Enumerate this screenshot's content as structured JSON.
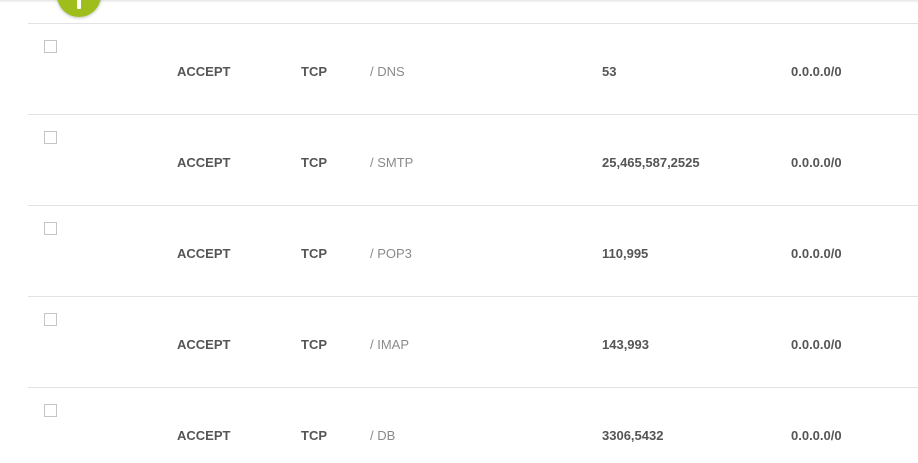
{
  "add_button": {
    "icon": "plus-icon",
    "color": "#9fbe1c"
  },
  "rules": [
    {
      "action": "ACCEPT",
      "protocol": "TCP",
      "service": "/ DNS",
      "ports": "53",
      "source": "0.0.0.0/0"
    },
    {
      "action": "ACCEPT",
      "protocol": "TCP",
      "service": "/ SMTP",
      "ports": "25,465,587,2525",
      "source": "0.0.0.0/0"
    },
    {
      "action": "ACCEPT",
      "protocol": "TCP",
      "service": "/ POP3",
      "ports": "110,995",
      "source": "0.0.0.0/0"
    },
    {
      "action": "ACCEPT",
      "protocol": "TCP",
      "service": "/ IMAP",
      "ports": "143,993",
      "source": "0.0.0.0/0"
    },
    {
      "action": "ACCEPT",
      "protocol": "TCP",
      "service": "/ DB",
      "ports": "3306,5432",
      "source": "0.0.0.0/0"
    }
  ]
}
